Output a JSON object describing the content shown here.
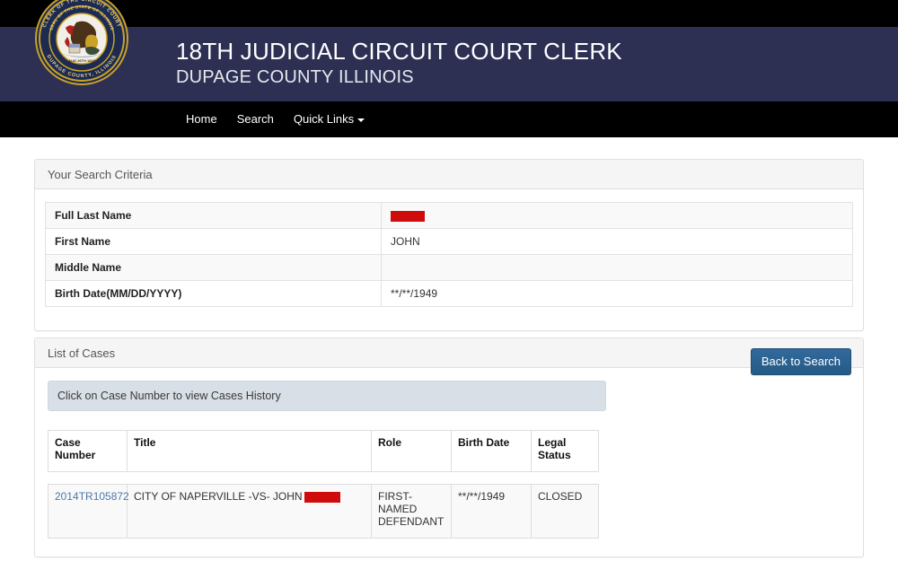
{
  "header": {
    "seal": {
      "outer_text": "CLERK OF THE CIRCUIT COURT",
      "inner_text": "SEAL OF THE STATE OF ILLINOIS",
      "bottom_text": "DUPAGE COUNTY, ILLINOIS",
      "date_text": "AUG 26TH 1818"
    },
    "title": "18TH JUDICIAL CIRCUIT COURT CLERK",
    "subtitle": "DUPAGE COUNTY ILLINOIS",
    "band_color": "#2d3053",
    "bar_color": "#000000"
  },
  "nav": {
    "items": [
      {
        "label": "Home",
        "has_caret": false
      },
      {
        "label": "Search",
        "has_caret": false
      },
      {
        "label": "Quick Links",
        "has_caret": true
      }
    ]
  },
  "criteria_panel": {
    "title": "Your Search Criteria",
    "rows": [
      {
        "label": "Full Last Name",
        "value": "",
        "redacted": true
      },
      {
        "label": "First Name",
        "value": "JOHN",
        "redacted": false
      },
      {
        "label": "Middle Name",
        "value": "",
        "redacted": false
      },
      {
        "label": "Birth Date(MM/DD/YYYY)",
        "value": "**/**/1949",
        "redacted": false
      }
    ]
  },
  "cases_panel": {
    "title": "List of Cases",
    "back_button_label": "Back to Search",
    "info_message": "Click on Case Number to view Cases History",
    "columns": [
      "Case Number",
      "Title",
      "Role",
      "Birth Date",
      "Legal Status"
    ],
    "rows": [
      {
        "case_number": "2014TR105872",
        "title_prefix": "CITY OF NAPERVILLE -VS- JOHN",
        "title_redacted": true,
        "role": "FIRST-NAMED DEFENDANT",
        "birth_date": "**/**/1949",
        "legal_status": "CLOSED"
      }
    ]
  },
  "colors": {
    "redaction": "#d00b0b",
    "link": "#4a78a8",
    "button": "#2a6496",
    "info_bg": "#d8dfe6"
  }
}
